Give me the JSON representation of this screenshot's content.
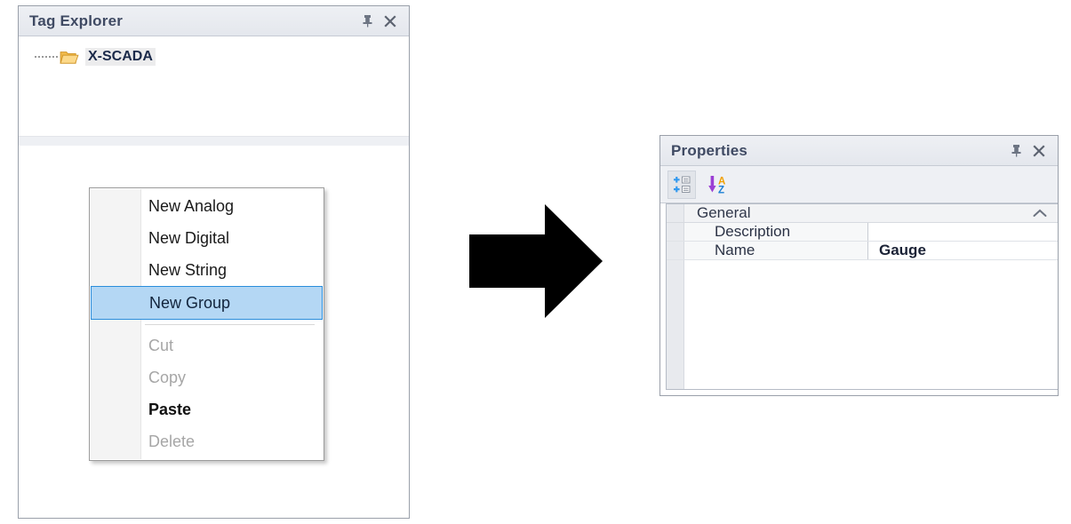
{
  "tag_explorer": {
    "title": "Tag Explorer",
    "pin_icon": "pin-icon",
    "close_icon": "close-icon",
    "tree": {
      "root": {
        "label": "X-SCADA",
        "icon": "open-folder-icon",
        "selected": true
      }
    }
  },
  "context_menu": {
    "items": [
      {
        "label": "New Analog",
        "state": "enabled"
      },
      {
        "label": "New Digital",
        "state": "enabled"
      },
      {
        "label": "New String",
        "state": "enabled"
      },
      {
        "label": "New Group",
        "state": "selected"
      },
      {
        "label": "Cut",
        "state": "disabled"
      },
      {
        "label": "Copy",
        "state": "disabled"
      },
      {
        "label": "Paste",
        "state": "enabled-bold"
      },
      {
        "label": "Delete",
        "state": "disabled"
      }
    ]
  },
  "flow": {
    "arrow_icon": "right-arrow-icon"
  },
  "properties": {
    "title": "Properties",
    "pin_icon": "pin-icon",
    "close_icon": "close-icon",
    "toolbar": {
      "categorized_icon": "categorized-view-icon",
      "alphabetical_icon": "alphabetical-sort-icon"
    },
    "grid": {
      "category": {
        "label": "General",
        "collapse_icon": "chevron-up-icon",
        "expanded": true
      },
      "rows": [
        {
          "name": "Description",
          "value": ""
        },
        {
          "name": "Name",
          "value": "Gauge"
        }
      ]
    }
  },
  "colors": {
    "selection_fill": "#b4d7f4",
    "selection_border": "#2a8ddb",
    "panel_title_text": "#3f4a63",
    "folder_yellow": "#f5c460",
    "arrow_black": "#000000",
    "sort_arrow_purple": "#9b3fd4",
    "sort_a_orange": "#f0a000",
    "sort_z_blue": "#1b7fd4",
    "plus_blue": "#3399ee"
  }
}
